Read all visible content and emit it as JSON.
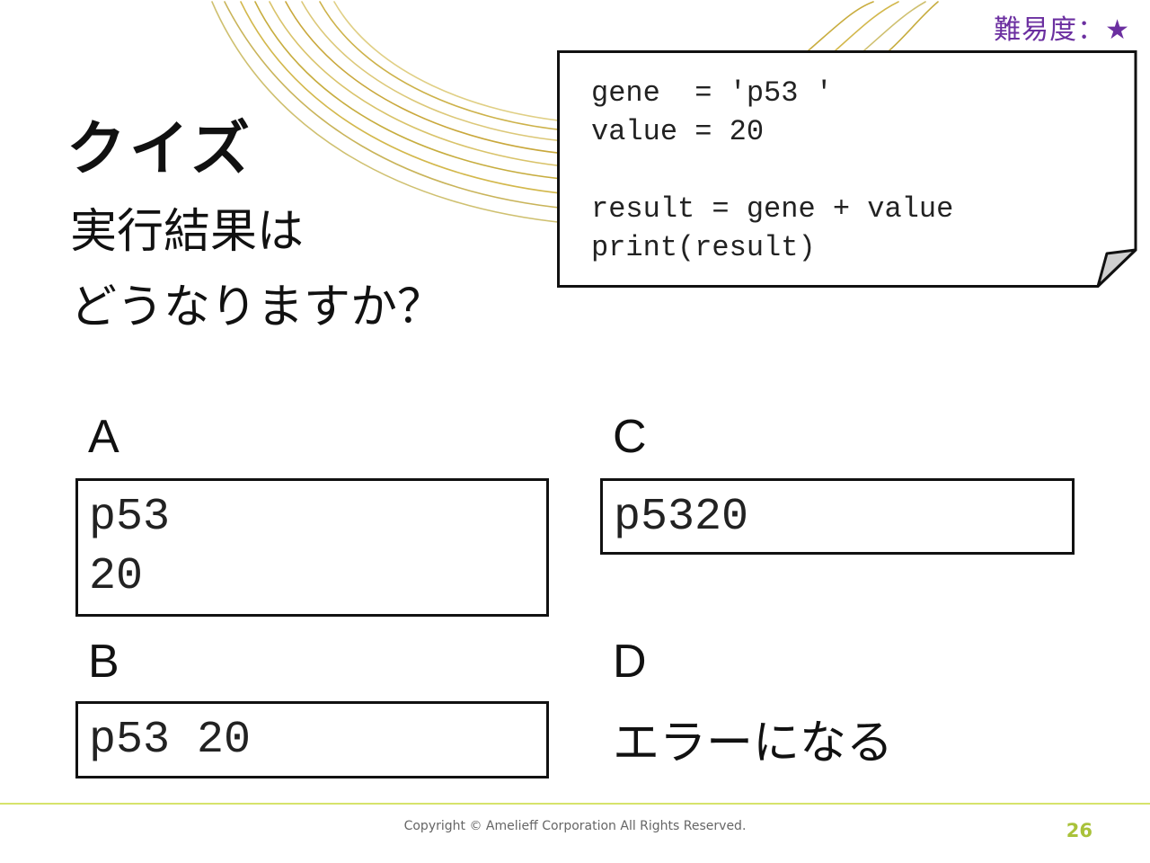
{
  "header": {
    "difficulty": "難易度：★"
  },
  "slide": {
    "title": "クイズ",
    "question_line1": "実行結果は",
    "question_line2": "どうなりますか？"
  },
  "code": {
    "text": "gene  = 'p53 '\nvalue = 20\n\nresult = gene + value\nprint(result)"
  },
  "options": {
    "a": {
      "label": "A",
      "answer": "p53\n20"
    },
    "b": {
      "label": "B",
      "answer": "p53 20"
    },
    "c": {
      "label": "C",
      "answer": "p5320"
    },
    "d": {
      "label": "D",
      "answer": "エラーになる"
    }
  },
  "footer": {
    "copyright": "Copyright © Amelieff Corporation All Rights Reserved.",
    "page": "26"
  },
  "colors": {
    "accent_purple": "#6b2fa0",
    "accent_green": "#a9c23a",
    "decor_gold": "#c8a838"
  }
}
